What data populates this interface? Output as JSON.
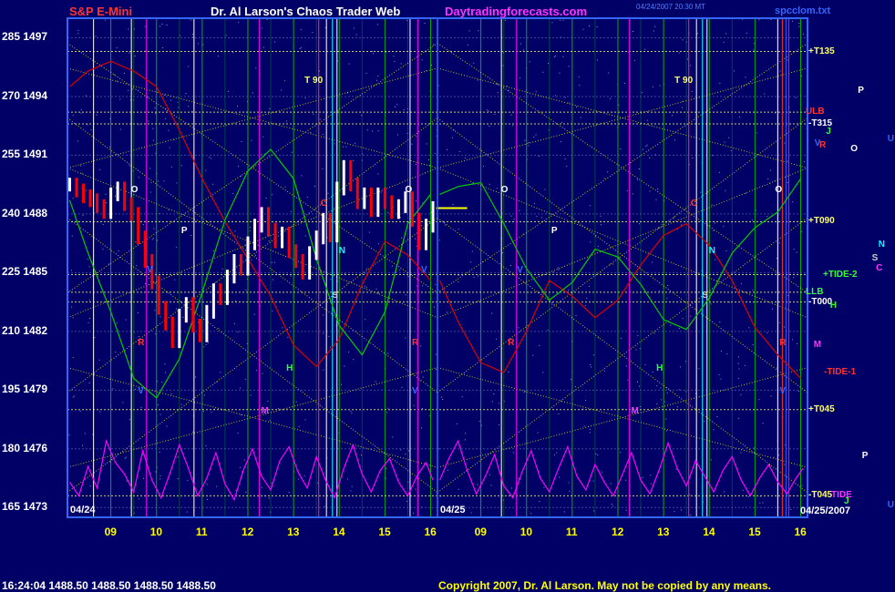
{
  "header": {
    "instrument": "S&P E-Mini",
    "title": "Dr. Al Larson's Chaos Trader Web",
    "site": "Daytradingforecasts.com",
    "timestamp_line1": "04/24/2007 20:30 MT",
    "file": "spcclom.txt"
  },
  "footer": {
    "quote": "16:24:04  1488.50  1488.50  1488.50  1488.50",
    "copyright": "Copyright 2007, Dr. Al Larson. May not be copied by any means."
  },
  "colors": {
    "background": "#000066",
    "price_up": "#ffffff",
    "price_down": "#ff0000",
    "grid_hours": "#00cc00",
    "flux": "#ffff00",
    "red_line": "#dd0000",
    "green_line": "#00cc00",
    "magenta_line": "#ff00ff"
  },
  "chart_data": {
    "type": "line",
    "ylim": [
      1472.5,
      1498
    ],
    "y_ticks": [
      {
        "left": "285",
        "price": 1497
      },
      {
        "left": "270",
        "price": 1494
      },
      {
        "left": "255",
        "price": 1491
      },
      {
        "left": "240",
        "price": 1488
      },
      {
        "left": "225",
        "price": 1485
      },
      {
        "left": "210",
        "price": 1482
      },
      {
        "left": "195",
        "price": 1479
      },
      {
        "left": "180",
        "price": 1476
      },
      {
        "left": "165",
        "price": 1473
      }
    ],
    "xlim": [
      8.05,
      16.15
    ],
    "x_ticks": [
      {
        "label": "09",
        "day": 0,
        "x": 9
      },
      {
        "label": "10",
        "day": 0,
        "x": 10
      },
      {
        "label": "11",
        "day": 0,
        "x": 11
      },
      {
        "label": "12",
        "day": 0,
        "x": 12
      },
      {
        "label": "13",
        "day": 0,
        "x": 13
      },
      {
        "label": "14",
        "day": 0,
        "x": 14
      },
      {
        "label": "15",
        "day": 0,
        "x": 15
      },
      {
        "label": "16",
        "day": 0,
        "x": 16
      },
      {
        "label": "09",
        "day": 1,
        "x": 9
      },
      {
        "label": "10",
        "day": 1,
        "x": 10
      },
      {
        "label": "11",
        "day": 1,
        "x": 11
      },
      {
        "label": "12",
        "day": 1,
        "x": 12
      },
      {
        "label": "13",
        "day": 1,
        "x": 13
      },
      {
        "label": "14",
        "day": 1,
        "x": 14
      },
      {
        "label": "15",
        "day": 1,
        "x": 15
      },
      {
        "label": "16",
        "day": 1,
        "x": 16
      }
    ],
    "date_labels": [
      {
        "text": "04/24",
        "day": 0
      },
      {
        "text": "04/25",
        "day": 1
      },
      {
        "text": "04/25/2007",
        "day": 1
      }
    ],
    "price_series": {
      "name": "",
      "day": 0,
      "x": [
        8.1,
        8.25,
        8.4,
        8.55,
        8.7,
        8.85,
        9.0,
        9.15,
        9.3,
        9.45,
        9.6,
        9.75,
        9.9,
        10.05,
        10.2,
        10.35,
        10.5,
        10.65,
        10.8,
        10.95,
        11.1,
        11.25,
        11.4,
        11.55,
        11.7,
        11.85,
        12.0,
        12.15,
        12.3,
        12.45,
        12.6,
        12.75,
        12.9,
        13.05,
        13.2,
        13.35,
        13.5,
        13.65,
        13.8,
        13.95,
        14.1,
        14.25,
        14.4,
        14.55,
        14.7,
        14.85,
        15.0,
        15.15,
        15.3,
        15.45,
        15.6,
        15.75,
        15.9,
        16.05
      ],
      "y": [
        1489.5,
        1489.2,
        1488.9,
        1488.7,
        1488.4,
        1488.1,
        1489.0,
        1489.3,
        1488.5,
        1488.0,
        1486.8,
        1485.6,
        1484.5,
        1483.2,
        1482.4,
        1481.5,
        1482.8,
        1483.4,
        1482.3,
        1481.8,
        1483.0,
        1484.1,
        1483.7,
        1484.8,
        1485.6,
        1485.2,
        1486.5,
        1487.4,
        1488.0,
        1487.2,
        1486.6,
        1487.0,
        1486.1,
        1485.6,
        1485.0,
        1486.0,
        1486.8,
        1487.7,
        1486.9,
        1489.3,
        1490.4,
        1489.5,
        1488.6,
        1489.0,
        1488.2,
        1489.0,
        1488.6,
        1488.1,
        1488.4,
        1488.8,
        1487.7,
        1486.5,
        1487.4,
        1488.3
      ]
    },
    "overlay_curves": [
      {
        "name": "",
        "color": "#dd0000",
        "day": 0,
        "x": [
          8.1,
          8.5,
          9.0,
          9.5,
          10.0,
          10.5,
          11.0,
          11.5,
          12.0,
          12.5,
          13.0,
          13.5,
          14.0,
          14.5,
          15.0,
          15.5,
          16.0
        ],
        "y": [
          1494.5,
          1495.3,
          1495.8,
          1495.3,
          1494.5,
          1492.3,
          1489.8,
          1487.6,
          1485.7,
          1483.8,
          1481.3,
          1480.2,
          1481.6,
          1484.4,
          1486.6,
          1485.9,
          1484.6
        ]
      },
      {
        "name": "",
        "color": "#00cc00",
        "day": 0,
        "x": [
          8.1,
          8.5,
          9.0,
          9.5,
          10.0,
          10.5,
          11.0,
          11.5,
          12.0,
          12.5,
          13.0,
          13.5,
          14.0,
          14.5,
          15.0,
          15.5,
          16.0
        ],
        "y": [
          1488.7,
          1486.0,
          1483.0,
          1479.6,
          1478.6,
          1480.6,
          1484.0,
          1487.7,
          1490.2,
          1491.3,
          1489.8,
          1485.7,
          1482.3,
          1480.8,
          1483.0,
          1487.5,
          1489.0
        ]
      },
      {
        "name": "",
        "color": "#dd0000",
        "day": 1,
        "x": [
          8.1,
          8.5,
          9.0,
          9.5,
          10.0,
          10.5,
          11.0,
          11.5,
          12.0,
          12.5,
          13.0,
          13.5,
          14.0,
          14.5,
          15.0,
          15.5,
          16.0
        ],
        "y": [
          1484.6,
          1482.5,
          1480.4,
          1479.9,
          1482.0,
          1484.6,
          1483.8,
          1482.7,
          1483.6,
          1485.4,
          1486.9,
          1487.5,
          1486.4,
          1484.6,
          1482.2,
          1480.8,
          1479.6
        ]
      },
      {
        "name": "",
        "color": "#00cc00",
        "day": 1,
        "x": [
          8.1,
          8.5,
          9.0,
          9.5,
          10.0,
          10.5,
          11.0,
          11.5,
          12.0,
          12.5,
          13.0,
          13.5,
          14.0,
          14.5,
          15.0,
          15.5,
          16.0
        ],
        "y": [
          1489.0,
          1489.4,
          1489.6,
          1487.5,
          1485.2,
          1483.6,
          1484.5,
          1486.2,
          1485.8,
          1484.4,
          1482.6,
          1482.1,
          1483.7,
          1486.0,
          1487.3,
          1488.1,
          1489.8
        ]
      },
      {
        "name": "",
        "color": "#ff00ff",
        "day": 0,
        "x": [
          8.1,
          8.3,
          8.5,
          8.7,
          8.9,
          9.1,
          9.3,
          9.5,
          9.7,
          9.9,
          10.1,
          10.3,
          10.5,
          10.7,
          10.9,
          11.1,
          11.3,
          11.5,
          11.7,
          11.9,
          12.1,
          12.3,
          12.5,
          12.7,
          12.9,
          13.1,
          13.3,
          13.5,
          13.7,
          13.9,
          14.1,
          14.3,
          14.5,
          14.7,
          14.9,
          15.1,
          15.3,
          15.5,
          15.7,
          15.9,
          16.05
        ],
        "y": [
          1474.3,
          1473.6,
          1475.1,
          1474.0,
          1476.4,
          1475.3,
          1474.7,
          1473.8,
          1475.9,
          1474.4,
          1473.5,
          1474.8,
          1476.2,
          1475.0,
          1473.6,
          1474.5,
          1475.8,
          1474.2,
          1473.4,
          1474.9,
          1476.0,
          1474.6,
          1473.9,
          1475.4,
          1476.1,
          1474.8,
          1474.0,
          1475.6,
          1474.4,
          1473.5,
          1475.0,
          1476.2,
          1474.7,
          1473.8,
          1474.9,
          1475.5,
          1474.3,
          1473.6,
          1474.6,
          1475.3,
          1474.4
        ]
      },
      {
        "name": "",
        "color": "#ff00ff",
        "day": 1,
        "x": [
          8.1,
          8.3,
          8.5,
          8.7,
          8.9,
          9.1,
          9.3,
          9.5,
          9.7,
          9.9,
          10.1,
          10.3,
          10.5,
          10.7,
          10.9,
          11.1,
          11.3,
          11.5,
          11.7,
          11.9,
          12.1,
          12.3,
          12.5,
          12.7,
          12.9,
          13.1,
          13.3,
          13.5,
          13.7,
          13.9,
          14.1,
          14.3,
          14.5,
          14.7,
          14.9,
          15.1,
          15.3,
          15.5,
          15.7,
          15.9,
          16.05
        ],
        "y": [
          1474.4,
          1475.5,
          1476.4,
          1474.9,
          1473.7,
          1474.6,
          1475.7,
          1474.1,
          1473.5,
          1474.8,
          1475.9,
          1474.5,
          1473.8,
          1475.0,
          1476.1,
          1474.6,
          1473.9,
          1475.2,
          1474.3,
          1473.6,
          1474.7,
          1475.8,
          1474.4,
          1473.7,
          1474.9,
          1476.3,
          1475.0,
          1474.1,
          1475.4,
          1474.6,
          1473.8,
          1474.9,
          1475.6,
          1474.4,
          1473.6,
          1474.5,
          1475.2,
          1474.3,
          1473.7,
          1474.5,
          1475.0
        ]
      }
    ],
    "horizontal_levels": [
      {
        "price": 1496.3,
        "label": "+T135",
        "label_color": "#ffff66"
      },
      {
        "price": 1493.2,
        "label": "ULB",
        "label_color": "#ff3333"
      },
      {
        "price": 1492.6,
        "label": "-T315",
        "label_color": "#ffffff"
      },
      {
        "price": 1487.6,
        "label": "+T090",
        "label_color": "#ffff66"
      },
      {
        "price": 1484.9,
        "label": "+TIDE-2",
        "label_color": "#33ff33"
      },
      {
        "price": 1484.0,
        "label": "LLB",
        "label_color": "#33ff33"
      },
      {
        "price": 1483.5,
        "label": "-T000",
        "label_color": "#ffffff"
      },
      {
        "price": 1478.0,
        "label": "+T045",
        "label_color": "#ffff66"
      },
      {
        "price": 1473.6,
        "label": "-T045",
        "label_color": "#ffff66"
      }
    ],
    "right_labels": [
      {
        "text": "-TIDE-1",
        "price": 1479.9,
        "color": "#ff3333"
      },
      {
        "text": "TIDE",
        "price": 1473.6,
        "color": "#ff33ff"
      }
    ],
    "vertical_lines": [
      {
        "day": 0,
        "x": 8.62,
        "color": "#ffffff"
      },
      {
        "day": 0,
        "x": 9.45,
        "color": "#ffffff"
      },
      {
        "day": 0,
        "x": 9.78,
        "color": "#ff00ff"
      },
      {
        "day": 0,
        "x": 10.82,
        "color": "#ffffff"
      },
      {
        "day": 0,
        "x": 12.25,
        "color": "#ff00ff"
      },
      {
        "day": 0,
        "x": 13.55,
        "color": "#ff3333"
      },
      {
        "day": 0,
        "x": 13.72,
        "color": "#ffffff"
      },
      {
        "day": 0,
        "x": 13.85,
        "color": "#00ffff"
      },
      {
        "day": 0,
        "x": 13.95,
        "color": "#ffffff"
      },
      {
        "day": 0,
        "x": 15.55,
        "color": "#ffffff"
      },
      {
        "day": 0,
        "x": 15.72,
        "color": "#ff00ff"
      },
      {
        "day": 1,
        "x": 9.45,
        "color": "#ffffff"
      },
      {
        "day": 1,
        "x": 9.78,
        "color": "#ff00ff"
      },
      {
        "day": 1,
        "x": 12.25,
        "color": "#ff00ff"
      },
      {
        "day": 1,
        "x": 13.55,
        "color": "#ff3333"
      },
      {
        "day": 1,
        "x": 13.72,
        "color": "#ffffff"
      },
      {
        "day": 1,
        "x": 13.85,
        "color": "#00ffff"
      },
      {
        "day": 1,
        "x": 13.95,
        "color": "#ffffff"
      },
      {
        "day": 1,
        "x": 15.5,
        "color": "#ffffff"
      },
      {
        "day": 1,
        "x": 15.6,
        "color": "#ff3333"
      },
      {
        "day": 1,
        "x": 15.68,
        "color": "#3366ff"
      },
      {
        "day": 1,
        "x": 15.74,
        "color": "#ff00ff"
      }
    ],
    "annotations": [
      {
        "text": "T 90",
        "day": 0,
        "x": 13.3,
        "price": 1494.8,
        "color": "#ffff66"
      },
      {
        "text": "T 90",
        "day": 1,
        "x": 13.3,
        "price": 1494.8,
        "color": "#ffff66"
      },
      {
        "text": "O",
        "day": 0,
        "x": 9.5,
        "price": 1489.2,
        "color": "#ffffff"
      },
      {
        "text": "O",
        "day": 0,
        "x": 15.5,
        "price": 1489.2,
        "color": "#ffffff"
      },
      {
        "text": "O",
        "day": 1,
        "x": 9.5,
        "price": 1489.2,
        "color": "#ffffff"
      },
      {
        "text": "O",
        "day": 1,
        "x": 15.5,
        "price": 1489.2,
        "color": "#ffffff"
      },
      {
        "text": "P",
        "day": 0,
        "x": 10.6,
        "price": 1487.1,
        "color": "#ffffff"
      },
      {
        "text": "P",
        "day": 1,
        "x": 10.6,
        "price": 1487.1,
        "color": "#ffffff"
      },
      {
        "text": "C",
        "day": 0,
        "x": 13.65,
        "price": 1488.5,
        "color": "#ff3333"
      },
      {
        "text": "C",
        "day": 1,
        "x": 13.65,
        "price": 1488.5,
        "color": "#ff3333"
      },
      {
        "text": "N",
        "day": 0,
        "x": 14.05,
        "price": 1486.1,
        "color": "#00ffff"
      },
      {
        "text": "N",
        "day": 1,
        "x": 14.05,
        "price": 1486.1,
        "color": "#00ffff"
      },
      {
        "text": "S",
        "day": 0,
        "x": 13.9,
        "price": 1483.8,
        "color": "#cccccc"
      },
      {
        "text": "S",
        "day": 1,
        "x": 13.9,
        "price": 1483.8,
        "color": "#cccccc"
      },
      {
        "text": "V",
        "day": 0,
        "x": 9.85,
        "price": 1485.1,
        "color": "#3366ff"
      },
      {
        "text": "V",
        "day": 0,
        "x": 15.85,
        "price": 1485.1,
        "color": "#3366ff"
      },
      {
        "text": "V",
        "day": 1,
        "x": 9.85,
        "price": 1485.1,
        "color": "#3366ff"
      },
      {
        "text": "V",
        "day": 0,
        "x": 9.65,
        "price": 1478.9,
        "color": "#3366ff"
      },
      {
        "text": "V",
        "day": 0,
        "x": 15.65,
        "price": 1478.9,
        "color": "#3366ff"
      },
      {
        "text": "V",
        "day": 1,
        "x": 15.6,
        "price": 1478.9,
        "color": "#3366ff"
      },
      {
        "text": "R",
        "day": 0,
        "x": 9.65,
        "price": 1481.4,
        "color": "#ff3333"
      },
      {
        "text": "R",
        "day": 0,
        "x": 15.65,
        "price": 1481.4,
        "color": "#ff3333"
      },
      {
        "text": "R",
        "day": 1,
        "x": 9.65,
        "price": 1481.4,
        "color": "#ff3333"
      },
      {
        "text": "R",
        "day": 1,
        "x": 15.6,
        "price": 1481.4,
        "color": "#ff3333"
      },
      {
        "text": "H",
        "day": 0,
        "x": 12.9,
        "price": 1480.1,
        "color": "#33ff33"
      },
      {
        "text": "H",
        "day": 1,
        "x": 12.9,
        "price": 1480.1,
        "color": "#33ff33"
      },
      {
        "text": "M",
        "day": 0,
        "x": 12.35,
        "price": 1477.9,
        "color": "#ff33ff"
      },
      {
        "text": "M",
        "day": 1,
        "x": 12.35,
        "price": 1477.9,
        "color": "#ff33ff"
      }
    ],
    "side_letters": [
      {
        "text": "P",
        "x_frac": 0.57,
        "price": 1494.3,
        "color": "#ffffff"
      },
      {
        "text": "J",
        "x_frac": 0.18,
        "price": 1492.2,
        "color": "#33ff33"
      },
      {
        "text": "R",
        "x_frac": 0.1,
        "price": 1491.5,
        "color": "#ff3333"
      },
      {
        "text": "V",
        "x_frac": 0.04,
        "price": 1491.6,
        "color": "#3366ff"
      },
      {
        "text": "O",
        "x_frac": 0.48,
        "price": 1491.3,
        "color": "#ffffff"
      },
      {
        "text": "U",
        "x_frac": 0.93,
        "price": 1491.8,
        "color": "#3366ff"
      },
      {
        "text": "N",
        "x_frac": 0.82,
        "price": 1486.4,
        "color": "#00ffff"
      },
      {
        "text": "S",
        "x_frac": 0.74,
        "price": 1485.7,
        "color": "#cccccc"
      },
      {
        "text": "C",
        "x_frac": 0.79,
        "price": 1485.2,
        "color": "#ff33ff"
      },
      {
        "text": "H",
        "x_frac": 0.23,
        "price": 1483.3,
        "color": "#33ff33"
      },
      {
        "text": "M",
        "x_frac": 0.03,
        "price": 1481.3,
        "color": "#ff33ff"
      },
      {
        "text": "P",
        "x_frac": 0.62,
        "price": 1475.6,
        "color": "#ffffff"
      },
      {
        "text": "J",
        "x_frac": 0.4,
        "price": 1473.3,
        "color": "#33ff33"
      },
      {
        "text": "U",
        "x_frac": 0.93,
        "price": 1473.1,
        "color": "#3366ff"
      }
    ]
  }
}
